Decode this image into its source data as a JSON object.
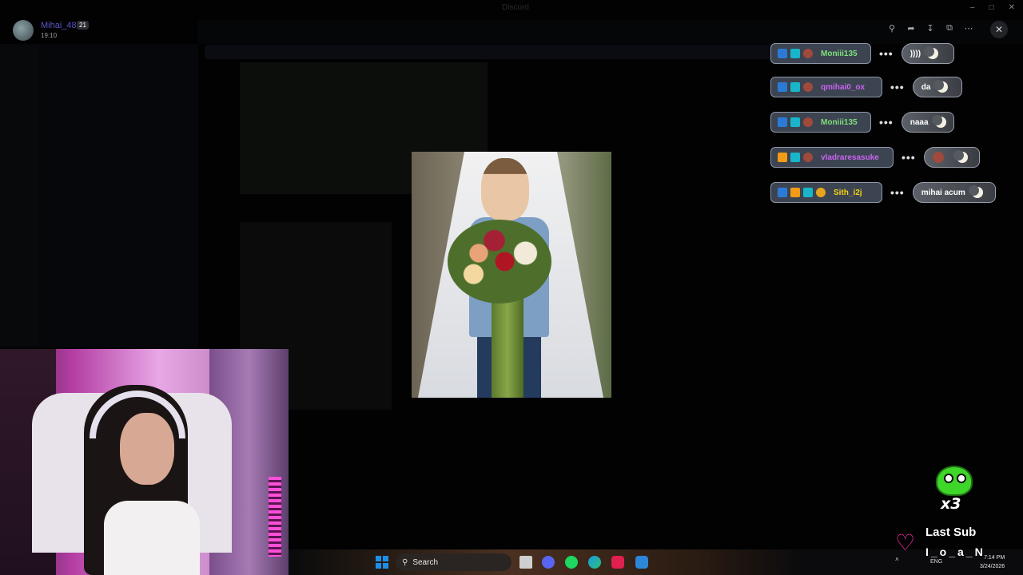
{
  "window": {
    "title": "Discord"
  },
  "author": {
    "name": "Mihai_48",
    "badge": "21",
    "time": "19:10"
  },
  "viewer_toolbar": {
    "icons": [
      "zoom-icon",
      "forward-icon",
      "download-icon",
      "open-external-icon",
      "more-icon"
    ]
  },
  "chat": {
    "rows": [
      {
        "username": "Moniii135",
        "message": "))))",
        "name_color": "#7fe07a",
        "badges": [
          "blue",
          "cyan",
          "face"
        ]
      },
      {
        "username": "qmihai0_ox",
        "message": "da",
        "name_color": "#c964f0",
        "badges": [
          "blue",
          "cyan",
          "face"
        ]
      },
      {
        "username": "Moniii135",
        "message": "naaa",
        "name_color": "#7fe07a",
        "badges": [
          "blue",
          "cyan",
          "face"
        ]
      },
      {
        "username": "vladraresasuke",
        "message": "",
        "name_color": "#c964f0",
        "badges": [
          "orange",
          "cyan",
          "face"
        ]
      },
      {
        "username": "Sith_i2j",
        "message": "mihai acum",
        "name_color": "#f2d21a",
        "badges": [
          "blue",
          "orange",
          "cyan",
          "gold"
        ]
      }
    ],
    "dots": "•••"
  },
  "taskbar": {
    "search_placeholder": "Search",
    "lang": "ENG",
    "time": "7:14 PM",
    "date": "3/24/2026"
  },
  "overlay": {
    "sub_count": "x3",
    "last_sub_label": "Last Sub",
    "last_sub_name": "I_o_a_N"
  },
  "colors": {
    "accent": "#5a55c8",
    "heart": "#ff2fa0",
    "frog": "#3fd62a"
  }
}
